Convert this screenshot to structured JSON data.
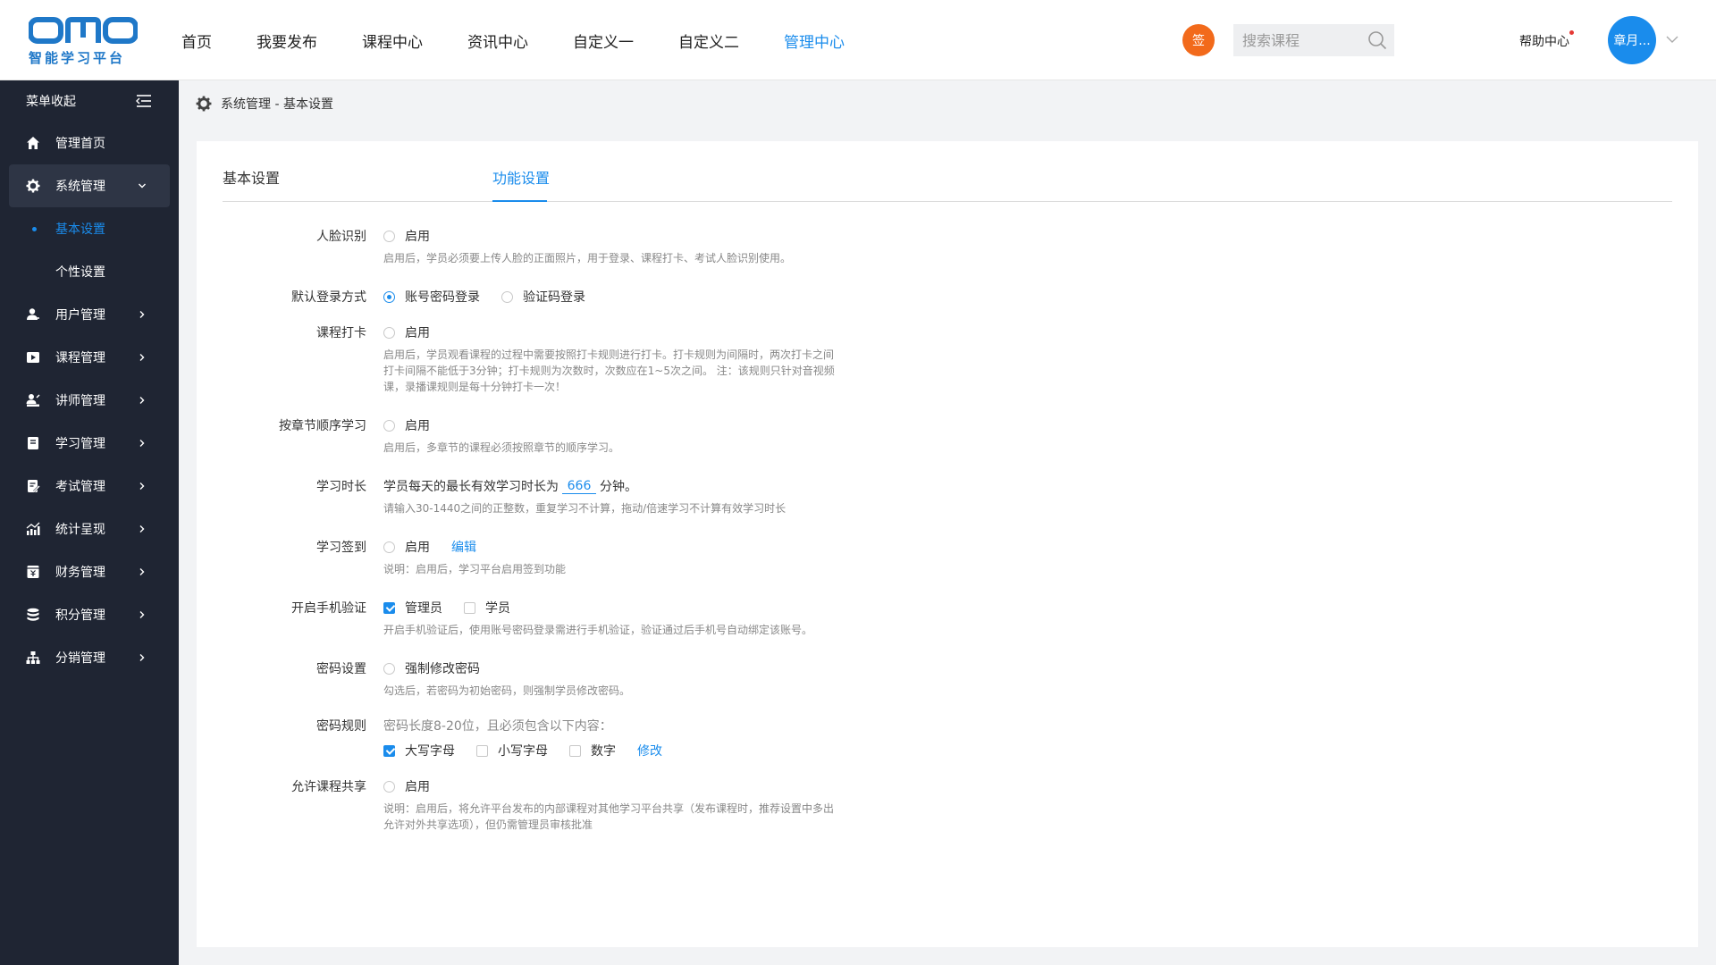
{
  "header": {
    "logo_text": "智能学习平台",
    "nav": [
      {
        "label": "首页"
      },
      {
        "label": "我要发布"
      },
      {
        "label": "课程中心"
      },
      {
        "label": "资讯中心"
      },
      {
        "label": "自定义一"
      },
      {
        "label": "自定义二"
      },
      {
        "label": "管理中心"
      }
    ],
    "sign_label": "签",
    "search_placeholder": "搜索课程",
    "help_label": "帮助中心",
    "avatar_label": "章月..."
  },
  "sidebar": {
    "collapse_label": "菜单收起",
    "items": [
      {
        "label": "管理首页",
        "icon": "home-icon"
      },
      {
        "label": "系统管理",
        "icon": "gear-icon"
      },
      {
        "label": "用户管理",
        "icon": "user-icon"
      },
      {
        "label": "课程管理",
        "icon": "video-icon"
      },
      {
        "label": "讲师管理",
        "icon": "teacher-icon"
      },
      {
        "label": "学习管理",
        "icon": "book-icon"
      },
      {
        "label": "考试管理",
        "icon": "exam-icon"
      },
      {
        "label": "统计呈现",
        "icon": "chart-icon"
      },
      {
        "label": "财务管理",
        "icon": "finance-icon"
      },
      {
        "label": "积分管理",
        "icon": "database-icon"
      },
      {
        "label": "分销管理",
        "icon": "hierarchy-icon"
      }
    ],
    "sub_items": [
      {
        "label": "基本设置"
      },
      {
        "label": "个性设置"
      }
    ]
  },
  "breadcrumb": "系统管理 - 基本设置",
  "tabs": [
    {
      "label": "基本设置"
    },
    {
      "label": "功能设置"
    }
  ],
  "settings": {
    "face": {
      "label": "人脸识别",
      "opt": "启用",
      "desc": "启用后，学员必须要上传人脸的正面照片，用于登录、课程打卡、考试人脸识别使用。"
    },
    "login": {
      "label": "默认登录方式",
      "opt1": "账号密码登录",
      "opt2": "验证码登录"
    },
    "checkin": {
      "label": "课程打卡",
      "opt": "启用",
      "desc": "启用后，学员观看课程的过程中需要按照打卡规则进行打卡。打卡规则为间隔时，两次打卡之间打卡间隔不能低于3分钟；打卡规则为次数时，次数应在1~5次之间。 注：该规则只针对音视频课，录播课规则是每十分钟打卡一次！"
    },
    "sequence": {
      "label": "按章节顺序学习",
      "opt": "启用",
      "desc": "启用后，多章节的课程必须按照章节的顺序学习。"
    },
    "duration": {
      "label": "学习时长",
      "prefix": "学员每天的最长有效学习时长为",
      "value": "666",
      "suffix": "分钟。",
      "desc": "请输入30-1440之间的正整数，重复学习不计算，拖动/倍速学习不计算有效学习时长"
    },
    "study_sign": {
      "label": "学习签到",
      "opt": "启用",
      "link": "编辑",
      "desc": "说明：启用后，学习平台启用签到功能"
    },
    "phone": {
      "label": "开启手机验证",
      "opt1": "管理员",
      "opt2": "学员",
      "desc": "开启手机验证后，使用账号密码登录需进行手机验证，验证通过后手机号自动绑定该账号。"
    },
    "password": {
      "label": "密码设置",
      "opt": "强制修改密码",
      "desc": "勾选后，若密码为初始密码，则强制学员修改密码。"
    },
    "pwd_rule": {
      "label": "密码规则",
      "intro": "密码长度8-20位，且必须包含以下内容：",
      "opt1": "大写字母",
      "opt2": "小写字母",
      "opt3": "数字",
      "link": "修改"
    },
    "share": {
      "label": "允许课程共享",
      "opt": "启用",
      "desc": "说明：启用后，将允许平台发布的内部课程对其他学习平台共享（发布课程时，推荐设置中多出允许对外共享选项），但仍需管理员审核批准"
    }
  },
  "colors": {
    "accent": "#1a8cec",
    "sidebar_bg": "#1f2533",
    "sign": "#f26a1b"
  }
}
